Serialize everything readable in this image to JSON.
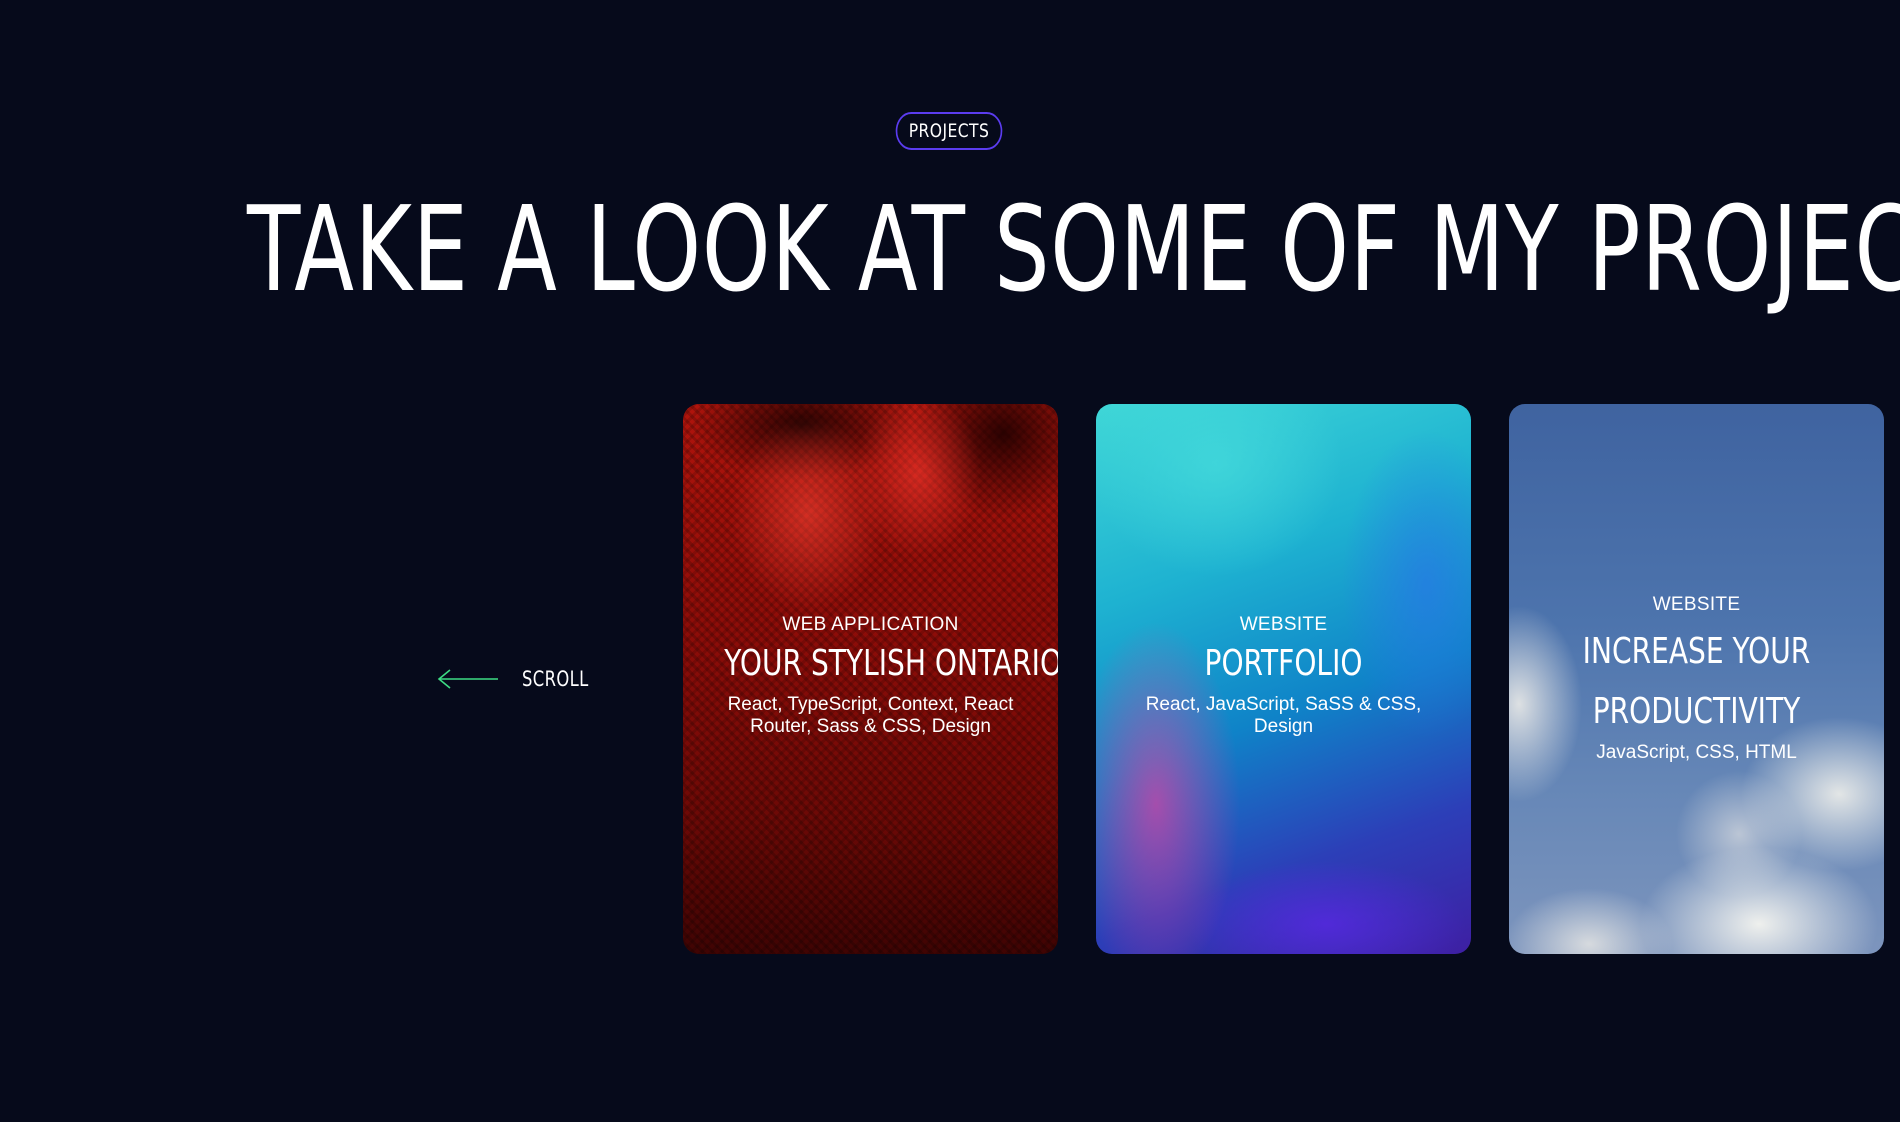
{
  "section": {
    "badge": "PROJECTS",
    "title": "TAKE A LOOK AT SOME OF MY PROJECTS"
  },
  "scroll_hint": {
    "label": "SCROLL",
    "arrow_icon": "arrow-left-icon",
    "arrow_color": "#3ddc84"
  },
  "colors": {
    "background": "#060a1b",
    "badge_border": "#5b3cf0",
    "text": "#ffffff"
  },
  "projects": [
    {
      "category": "WEB APPLICATION",
      "title": "YOUR STYLISH ONTARIO",
      "tech": "React, TypeScript, Context, React Router, Sass & CSS, Design"
    },
    {
      "category": "WEBSITE",
      "title": "PORTFOLIO",
      "tech": "React, JavaScript, SaSS & CSS, Design"
    },
    {
      "category": "WEBSITE",
      "title_line1": "INCREASE YOUR",
      "title_line2": "PRODUCTIVITY",
      "tech": "JavaScript, CSS, HTML"
    }
  ]
}
